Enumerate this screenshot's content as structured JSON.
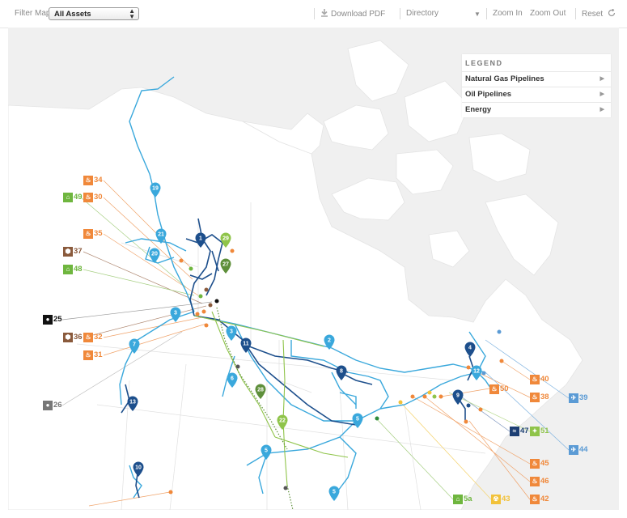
{
  "toolbar": {
    "filter_label": "Filter Map",
    "filter_value": "All Assets",
    "download_label": "Download PDF",
    "directory_label": "Directory",
    "zoom_in_label": "Zoom In",
    "zoom_out_label": "Zoom Out",
    "reset_label": "Reset"
  },
  "legend": {
    "title": "LEGEND",
    "items": [
      {
        "label": "Natural Gas Pipelines"
      },
      {
        "label": "Oil Pipelines"
      },
      {
        "label": "Energy"
      }
    ]
  },
  "colors": {
    "gas_pipeline": "#3aa8dc",
    "oil_pipeline": "#1d4f8c",
    "energy": "#f0883a",
    "land": "#ffffff",
    "water": "#f0f0f0"
  },
  "map_markers": [
    {
      "label": "1",
      "color": "#1d4f8c"
    },
    {
      "label": "2",
      "color": "#3aa8dc"
    },
    {
      "label": "3",
      "color": "#3aa8dc"
    },
    {
      "label": "3",
      "color": "#3aa8dc"
    },
    {
      "label": "4",
      "color": "#1d4f8c"
    },
    {
      "label": "5",
      "color": "#3aa8dc"
    },
    {
      "label": "5",
      "color": "#3aa8dc"
    },
    {
      "label": "5",
      "color": "#3aa8dc"
    },
    {
      "label": "6",
      "color": "#3aa8dc"
    },
    {
      "label": "7",
      "color": "#3aa8dc"
    },
    {
      "label": "8",
      "color": "#1d4f8c"
    },
    {
      "label": "9",
      "color": "#1d4f8c"
    },
    {
      "label": "10",
      "color": "#1d4f8c"
    },
    {
      "label": "11",
      "color": "#1d4f8c"
    },
    {
      "label": "12",
      "color": "#3aa8dc"
    },
    {
      "label": "13",
      "color": "#1d4f8c"
    },
    {
      "label": "19",
      "color": "#3aa8dc"
    },
    {
      "label": "20",
      "color": "#3aa8dc"
    },
    {
      "label": "21",
      "color": "#3aa8dc"
    },
    {
      "label": "22",
      "color": "#8fc44a"
    },
    {
      "label": "27",
      "color": "#5e8f3a"
    },
    {
      "label": "28",
      "color": "#5e8f3a"
    },
    {
      "label": "29",
      "color": "#8fc44a"
    }
  ],
  "asset_labels": [
    {
      "label": "34",
      "color": "orange",
      "icon": "flame-icon"
    },
    {
      "label": "49",
      "color": "green",
      "icon": "house-icon"
    },
    {
      "label": "30",
      "color": "orange",
      "icon": "flame-icon"
    },
    {
      "label": "35",
      "color": "orange",
      "icon": "flame-icon"
    },
    {
      "label": "37",
      "color": "brown",
      "icon": "storage-icon"
    },
    {
      "label": "48",
      "color": "green",
      "icon": "house-icon"
    },
    {
      "label": "25",
      "color": "black",
      "icon": "circle-icon"
    },
    {
      "label": "36",
      "color": "brown",
      "icon": "storage-icon"
    },
    {
      "label": "32",
      "color": "orange",
      "icon": "flame-icon"
    },
    {
      "label": "31",
      "color": "orange",
      "icon": "flame-icon"
    },
    {
      "label": "26",
      "color": "gray",
      "icon": "circle-icon"
    },
    {
      "label": "40",
      "color": "orange",
      "icon": "flame-icon"
    },
    {
      "label": "50",
      "color": "orange",
      "icon": "flame-icon"
    },
    {
      "label": "38",
      "color": "orange",
      "icon": "flame-icon"
    },
    {
      "label": "39",
      "color": "blue",
      "icon": "wind-icon"
    },
    {
      "label": "47",
      "color": "navy",
      "icon": "wave-icon"
    },
    {
      "label": "51",
      "color": "lime",
      "icon": "solar-icon"
    },
    {
      "label": "44",
      "color": "blue",
      "icon": "wind-icon"
    },
    {
      "label": "45",
      "color": "orange",
      "icon": "flame-icon"
    },
    {
      "label": "46",
      "color": "orange",
      "icon": "flame-icon"
    },
    {
      "label": "5a",
      "color": "green",
      "icon": "house-icon"
    },
    {
      "label": "43",
      "color": "gold",
      "icon": "nuclear-icon"
    },
    {
      "label": "42",
      "color": "orange",
      "icon": "flame-icon"
    }
  ]
}
